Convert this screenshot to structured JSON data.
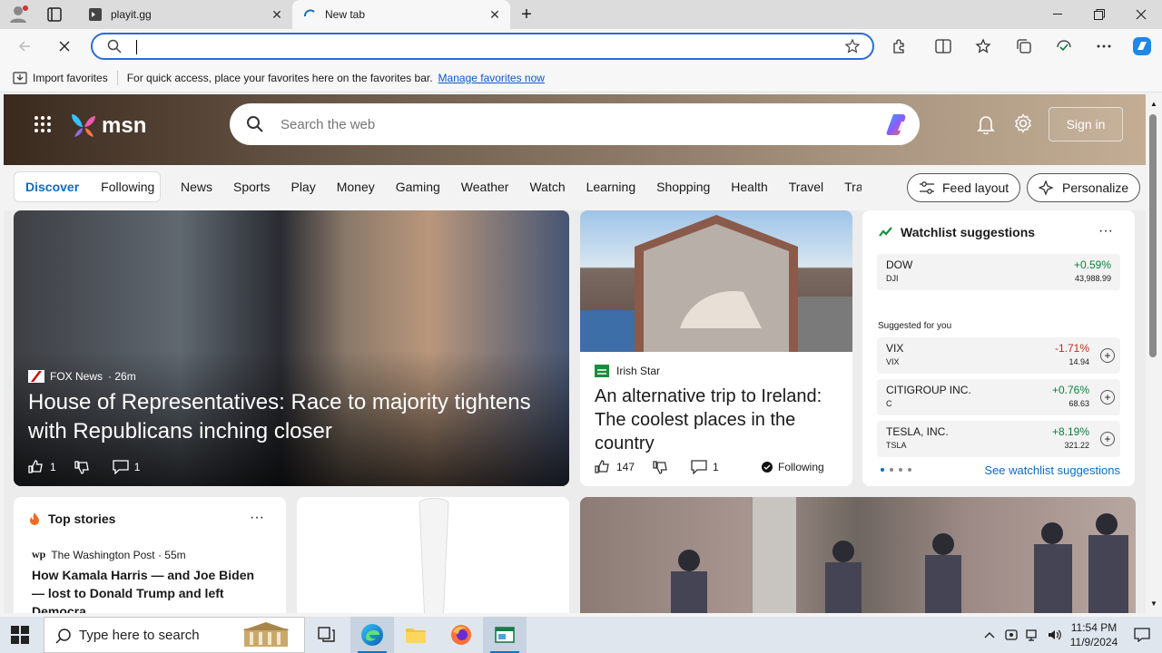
{
  "browser": {
    "tabs": [
      {
        "title": "playit.gg",
        "active": false
      },
      {
        "title": "New tab",
        "active": true
      }
    ],
    "address": {
      "value": "",
      "placeholder": ""
    },
    "favorites_bar": {
      "import_label": "Import favorites",
      "hint": "For quick access, place your favorites here on the favorites bar.",
      "manage_link": "Manage favorites now"
    }
  },
  "msn": {
    "logo": "msn",
    "search_placeholder": "Search the web",
    "sign_in": "Sign in",
    "segments": [
      "Discover",
      "Following"
    ],
    "nav": [
      "News",
      "Sports",
      "Play",
      "Money",
      "Gaming",
      "Weather",
      "Watch",
      "Learning",
      "Shopping",
      "Health",
      "Travel",
      "Traf"
    ],
    "feed_layout": "Feed layout",
    "personalize": "Personalize"
  },
  "hero": {
    "source": "FOX News",
    "age": "· 26m",
    "title": "House of Representatives: Race to majority tightens with Republicans inching closer",
    "likes": "1",
    "comments": "1"
  },
  "ireland": {
    "source": "Irish Star",
    "title": "An alternative trip to Ireland: The coolest places in the country",
    "likes": "147",
    "comments": "1",
    "following": "Following"
  },
  "watchlist": {
    "title": "Watchlist suggestions",
    "more": "···",
    "main": {
      "name": "DOW",
      "symbol": "DJI",
      "change": "+0.59%",
      "price": "43,988.99"
    },
    "suggested_label": "Suggested for you",
    "suggestions": [
      {
        "name": "VIX",
        "symbol": "VIX",
        "change": "-1.71%",
        "price": "14.94",
        "direction": "down"
      },
      {
        "name": "CITIGROUP INC.",
        "symbol": "C",
        "change": "+0.76%",
        "price": "68.63",
        "direction": "up"
      },
      {
        "name": "TESLA, INC.",
        "symbol": "TSLA",
        "change": "+8.19%",
        "price": "321.22",
        "direction": "up"
      }
    ],
    "link": "See watchlist suggestions"
  },
  "top_stories": {
    "title": "Top stories",
    "more": "···",
    "source": "The Washington Post · 55m",
    "headline": "How Kamala Harris — and Joe Biden — lost to Donald Trump and left Democra..."
  },
  "taskbar": {
    "search_placeholder": "Type here to search",
    "time": "11:54 PM",
    "date": "11/9/2024"
  },
  "colors": {
    "accent": "#0f6cbd",
    "omnibox_border": "#2b6cd6",
    "up": "#0a7f3f",
    "down": "#c42b1c"
  }
}
